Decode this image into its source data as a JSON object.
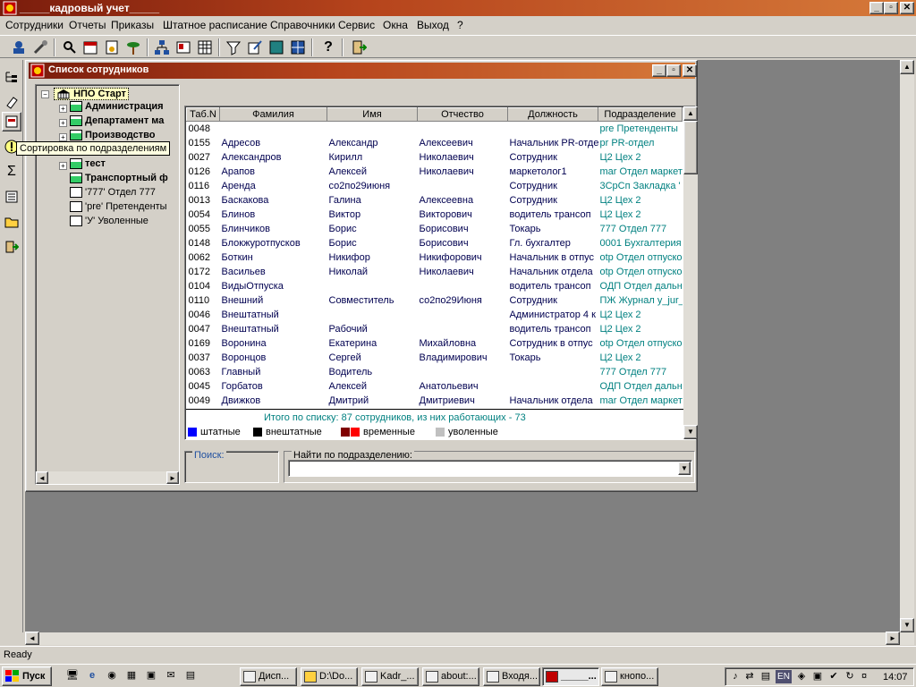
{
  "app": {
    "title": "_____кадровый учет_____",
    "status": "Ready",
    "caption_buttons": [
      "_",
      "▫",
      "✕"
    ]
  },
  "menu": [
    "Сотрудники",
    "Отчеты",
    "Приказы",
    "Штатное расписание",
    "Справочники",
    "Сервис",
    "Окна",
    "Выход",
    "?"
  ],
  "toolbar_icons": [
    "employees-icon",
    "tools-icon",
    "search-person-icon",
    "calendar-icon",
    "certificate-icon",
    "palm-icon",
    "org-chart-icon",
    "card-icon",
    "grid-icon",
    "filter-icon",
    "edit-icon",
    "monitor-icon",
    "frame-icon",
    "help-icon",
    "exit-icon"
  ],
  "left_toolbar_icons": [
    "tree-icon",
    "eraser-icon",
    "dept-sort-icon",
    "alert-icon",
    "sum-icon",
    "list-icon",
    "folder-icon",
    "exit-icon"
  ],
  "tooltip": "Сортировка по подразделениям",
  "child": {
    "title": "Список сотрудников",
    "buttons": [
      "_",
      "▫",
      "✕"
    ]
  },
  "tree": {
    "root": "НПО Старт",
    "items": [
      {
        "label": "Администрация",
        "bold": true,
        "expandable": true
      },
      {
        "label": "Департамент ма",
        "bold": true,
        "expandable": true
      },
      {
        "label": "Производство",
        "bold": true,
        "expandable": true
      },
      {
        "label": "тест",
        "bold": true,
        "expandable": true
      },
      {
        "label": "Транспортный ф",
        "bold": true,
        "expandable": false
      },
      {
        "label": "'777' Отдел 777",
        "bold": false,
        "expandable": false
      },
      {
        "label": "'pre' Претенденты",
        "bold": false,
        "expandable": false
      },
      {
        "label": "'У' Уволенные",
        "bold": false,
        "expandable": false
      }
    ]
  },
  "grid": {
    "columns": [
      "Таб.N",
      "Фамилия",
      "Имя",
      "Отчество",
      "Должность",
      "Подразделение"
    ],
    "rows": [
      [
        "0048",
        "",
        "",
        "",
        "",
        "pre  Претенденты"
      ],
      [
        "0155",
        "Адресов",
        "Александр",
        "Алексеевич",
        "Начальник PR-отде",
        "pr  PR-отдел"
      ],
      [
        "0027",
        "Александров",
        "Кирилл",
        "Николаевич",
        "Сотрудник",
        "Ц2  Цех 2"
      ],
      [
        "0126",
        "Арапов",
        "Алексей",
        "Николаевич",
        "маркетолог1",
        "mar  Отдел маркет"
      ],
      [
        "0116",
        "Аренда",
        "со2по29июня",
        "",
        "Сотрудник",
        "3СрСп  Закладка '"
      ],
      [
        "0013",
        "Баскакова",
        "Галина",
        "Алексеевна",
        "Сотрудник",
        "Ц2  Цех 2"
      ],
      [
        "0054",
        "Блинов",
        "Виктор",
        "Викторович",
        " водитель трансоп",
        "Ц2  Цех 2"
      ],
      [
        "0055",
        "Блинчиков",
        "Борис",
        "Борисович",
        "Токарь",
        "777  Отдел 777"
      ],
      [
        "0148",
        "Блокжуротпусков",
        "Борис",
        "Борисович",
        "Гл. бухгалтер",
        "0001  Бухгалтерия"
      ],
      [
        "0062",
        "Боткин",
        "Никифор",
        "Никифорович",
        "Начальник в отпус",
        "otp  Отдел отпуско"
      ],
      [
        "0172",
        "Васильев",
        "Николай",
        "Николаевич",
        "Начальник отдела",
        "otp  Отдел отпуско"
      ],
      [
        "0104",
        "ВидыОтпуска",
        "",
        "",
        " водитель трансоп",
        "ОДП  Отдел дальн"
      ],
      [
        "0110",
        "Внешний",
        "Совместитель",
        "со2по29Июня",
        "Сотрудник",
        "ПЖ  Журнал y_jur_"
      ],
      [
        "0046",
        "Внештатный",
        "",
        "",
        "Администратор 4 к",
        "Ц2  Цех 2"
      ],
      [
        "0047",
        "Внештатный",
        "Рабочий",
        "",
        " водитель трансоп",
        "Ц2  Цех 2"
      ],
      [
        "0169",
        "Воронина",
        "Екатерина",
        "Михайловна",
        "Сотрудник в отпус",
        "otp  Отдел отпуско"
      ],
      [
        "0037",
        "Воронцов",
        "Сергей",
        "Владимирович",
        "Токарь",
        "Ц2  Цех 2"
      ],
      [
        "0063",
        "Главный",
        "Водитель",
        "",
        "",
        "777  Отдел 777"
      ],
      [
        "0045",
        "Горбатов",
        "Алексей",
        "Анатольевич",
        "",
        "ОДП  Отдел дальн"
      ],
      [
        "0049",
        "Движков",
        "Дмитрий",
        "Дмитриевич",
        "Начальник отдела",
        "mar  Отдел маркет"
      ]
    ],
    "summary": "Итого по списку: 87 сотрудников, из них работающих - 73",
    "legend": [
      {
        "label": "штатные",
        "colors": [
          "#0000ff"
        ]
      },
      {
        "label": "внештатные",
        "colors": [
          "#000000"
        ]
      },
      {
        "label": "временные",
        "colors": [
          "#800000",
          "#ff0000"
        ]
      },
      {
        "label": "уволенные",
        "colors": [
          "#c0c0c0"
        ]
      }
    ]
  },
  "search": {
    "label": "Поиск:"
  },
  "dept_search": {
    "label": "Найти по подразделению:",
    "value": ""
  },
  "taskbar": {
    "start": "Пуск",
    "tasks": [
      "Дисп...",
      "D:\\Do...",
      "Kadr_...",
      "about:...",
      "Входя...",
      "_____...",
      "кнопо..."
    ],
    "tray": [
      "EN"
    ],
    "clock": "14:07"
  }
}
